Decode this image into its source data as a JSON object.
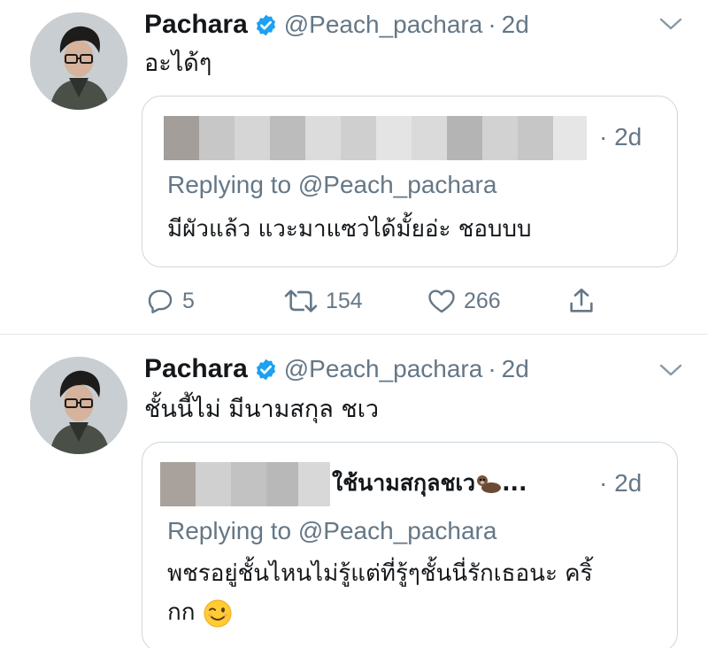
{
  "tweets": [
    {
      "author": {
        "name": "Pachara",
        "handle": "@Peach_pachara",
        "verified": true
      },
      "separator": "·",
      "time": "2d",
      "text": "อะได้ๆ",
      "quoted": {
        "time": "· 2d",
        "replying_to": "Replying to @Peach_pachara",
        "text": "มีผัวแล้ว แวะมาแซวได้มั้ยอ่ะ ชอบบบ"
      },
      "actions": {
        "reply_count": "5",
        "retweet_count": "154",
        "like_count": "266"
      }
    },
    {
      "author": {
        "name": "Pachara",
        "handle": "@Peach_pachara",
        "verified": true
      },
      "separator": "·",
      "time": "2d",
      "text": "ชั้นนี้ไม่ มีนามสกุล ชเว",
      "quoted": {
        "name_visible": "ใช้นามสกุลชเว",
        "name_suffix": "...",
        "time": "· 2d",
        "replying_to": "Replying to @Peach_pachara",
        "text_line1": "พชรอยู่ชั้นไหนไม่รู้แต่ที่รู้ๆชั้นนี่รักเธอนะ คริ้",
        "text_line2": "กก"
      }
    }
  ],
  "icons": {
    "verified": "verified-badge-icon",
    "more": "chevron-down-icon",
    "reply": "reply-icon",
    "retweet": "retweet-icon",
    "like": "heart-icon",
    "share": "share-icon"
  },
  "colors": {
    "verified_blue": "#1da1f2",
    "secondary_text": "#657786",
    "primary_text": "#14171a",
    "border": "#ccd6dd"
  }
}
